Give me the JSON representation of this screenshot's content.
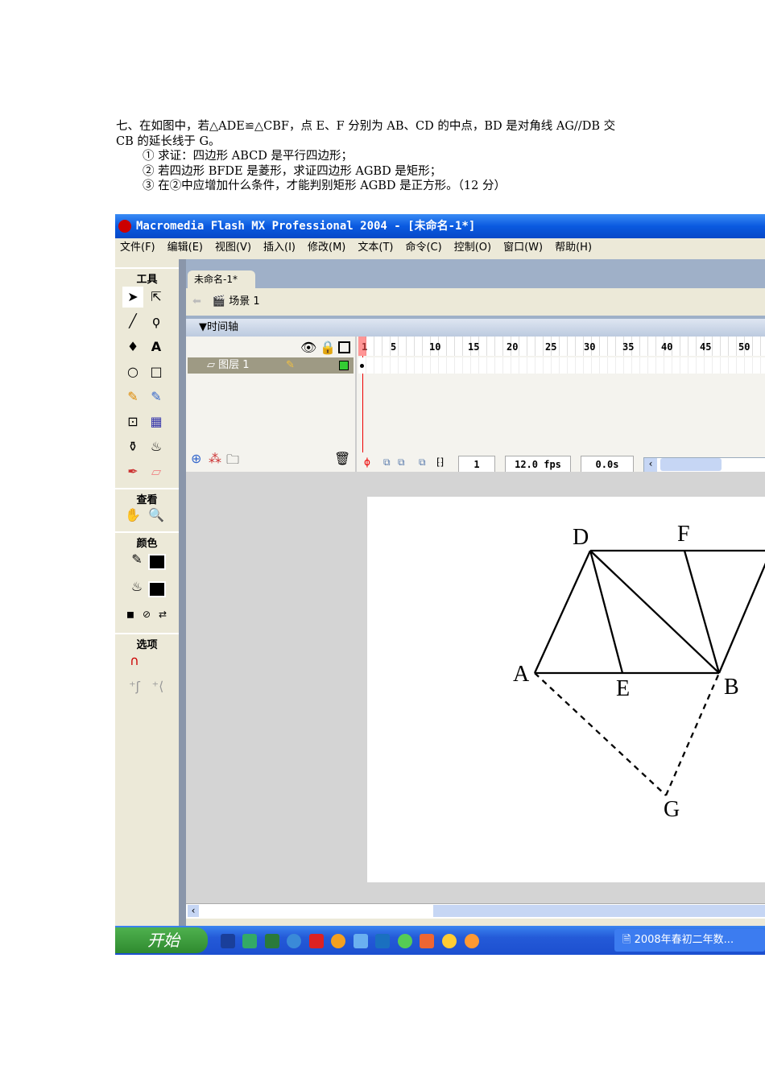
{
  "question": {
    "line1": "七、在如图中，若△ADE≌△CBF，点 E、F 分别为 AB、CD 的中点，BD 是对角线 AG//DB 交",
    "line2": "CB 的延长线于 G。",
    "item1": "① 求证：四边形 ABCD 是平行四边形；",
    "item2": "② 若四边形 BFDE 是菱形，求证四边形 AGBD 是矩形；",
    "item3": "③ 在②中应增加什么条件，才能判别矩形 AGBD 是正方形。（12 分）"
  },
  "app": {
    "title": "Macromedia Flash MX Professional 2004 - [未命名-1*]",
    "menu": [
      "文件(F)",
      "编辑(E)",
      "视图(V)",
      "插入(I)",
      "修改(M)",
      "文本(T)",
      "命令(C)",
      "控制(O)",
      "窗口(W)",
      "帮助(H)"
    ],
    "tools": {
      "header": "工具",
      "view": "查看",
      "colors": "颜色",
      "options": "选项"
    },
    "doc_tab": "未命名-1*",
    "scene": "场景 1",
    "timeline": "▼时间轴",
    "layer": "图层 1",
    "frames": [
      "1",
      "5",
      "10",
      "15",
      "20",
      "25",
      "30",
      "35",
      "40",
      "45",
      "50"
    ],
    "current_frame": "1",
    "fps": "12.0 fps",
    "time": "0.0s"
  },
  "diagram": {
    "labels": {
      "A": "A",
      "B": "B",
      "D": "D",
      "E": "E",
      "F": "F",
      "G": "G"
    }
  },
  "taskbar": {
    "start": "开始",
    "window": "2008年春初二年数..."
  }
}
